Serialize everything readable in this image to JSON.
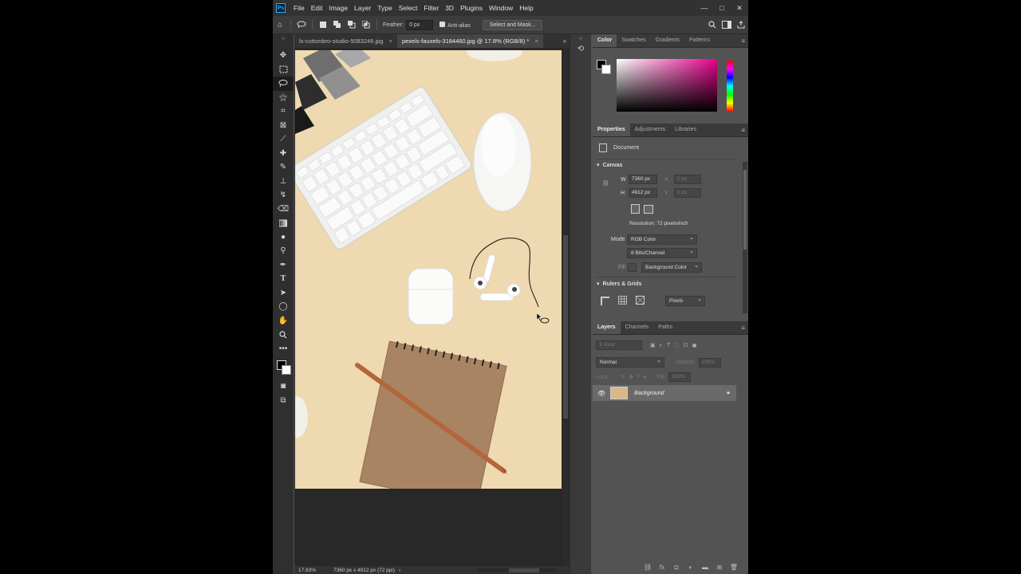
{
  "menu": {
    "logo": "Ps",
    "items": [
      "File",
      "Edit",
      "Image",
      "Layer",
      "Type",
      "Select",
      "Filter",
      "3D",
      "Plugins",
      "Window",
      "Help"
    ],
    "window_buttons": [
      "—",
      "□",
      "✕"
    ]
  },
  "options": {
    "feather_label": "Feather:",
    "feather_value": "0 px",
    "antialias_label": "Anti-alias",
    "select_mask_label": "Select and Mask..."
  },
  "tabs": [
    {
      "label": "ls-cottonbro-studio-5083246.jpg",
      "close": "×"
    },
    {
      "label": "pexels-fauxels-3184460.jpg @ 17.8% (RGB/8) *",
      "close": "×"
    }
  ],
  "status": {
    "zoom": "17.83%",
    "dimensions": "7360 px x 4912 px (72 ppi)",
    "arrow": "›"
  },
  "color_panel": {
    "tabs": [
      "Color",
      "Swatches",
      "Gradients",
      "Patterns"
    ]
  },
  "properties_panel": {
    "tabs": [
      "Properties",
      "Adjustments",
      "Libraries"
    ],
    "document_label": "Document",
    "canvas_title": "Canvas",
    "w_label": "W",
    "w_value": "7360 px",
    "h_label": "H",
    "h_value": "4912 px",
    "x_label": "X",
    "y_label": "Y",
    "x_value": "0 px",
    "y_value": "0 px",
    "resolution": "Resolution: 72 pixels/inch",
    "mode_label": "Mode",
    "mode_value": "RGB Color",
    "bits_value": "8 Bits/Channel",
    "fill_label": "Fill",
    "fill_value": "Background Color",
    "rulers_title": "Rulers & Grids",
    "units_value": "Pixels"
  },
  "layers_panel": {
    "tabs": [
      "Layers",
      "Channels",
      "Paths"
    ],
    "kind_placeholder": "Kind",
    "blend_mode": "Normal",
    "opacity_label": "Opacity:",
    "opacity_value": "100%",
    "lock_label": "Lock:",
    "fill_label": "Fill:",
    "fill_value": "100%",
    "layer_name": "Background"
  }
}
